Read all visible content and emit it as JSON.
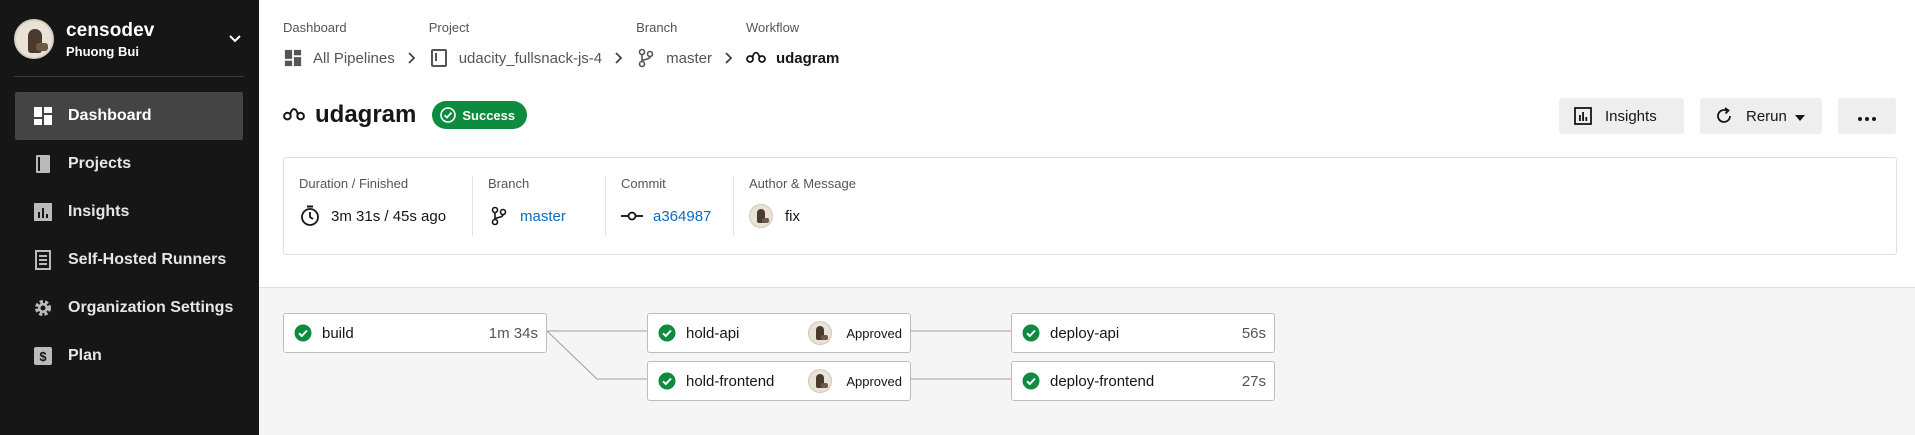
{
  "sidebar": {
    "org_name": "censodev",
    "user_name": "Phuong Bui",
    "items": [
      {
        "label": "Dashboard",
        "icon": "dashboard-icon"
      },
      {
        "label": "Projects",
        "icon": "book-icon"
      },
      {
        "label": "Insights",
        "icon": "chart-icon"
      },
      {
        "label": "Self-Hosted Runners",
        "icon": "server-icon"
      },
      {
        "label": "Organization Settings",
        "icon": "gear-icon"
      },
      {
        "label": "Plan",
        "icon": "dollar-icon"
      }
    ]
  },
  "breadcrumbs": [
    {
      "label": "Dashboard",
      "value": "All Pipelines"
    },
    {
      "label": "Project",
      "value": "udacity_fullsnack-js-4"
    },
    {
      "label": "Branch",
      "value": "master"
    },
    {
      "label": "Workflow",
      "value": "udagram"
    }
  ],
  "header": {
    "title": "udagram",
    "status": "Success",
    "status_color": "#0d8b3e",
    "insights_label": "Insights",
    "rerun_label": "Rerun"
  },
  "info": {
    "duration_label": "Duration / Finished",
    "duration_value": "3m 31s / 45s ago",
    "branch_label": "Branch",
    "branch_value": "master",
    "commit_label": "Commit",
    "commit_value": "a364987",
    "author_label": "Author & Message",
    "author_message": "fix"
  },
  "jobs": {
    "build": {
      "name": "build",
      "duration": "1m 34s"
    },
    "hold_api": {
      "name": "hold-api",
      "status": "Approved"
    },
    "hold_frontend": {
      "name": "hold-frontend",
      "status": "Approved"
    },
    "deploy_api": {
      "name": "deploy-api",
      "duration": "56s"
    },
    "deploy_frontend": {
      "name": "deploy-frontend",
      "duration": "27s"
    }
  },
  "colors": {
    "success": "#0d8b3e",
    "link": "#0a6dc2",
    "sidebar_bg": "#161616"
  }
}
